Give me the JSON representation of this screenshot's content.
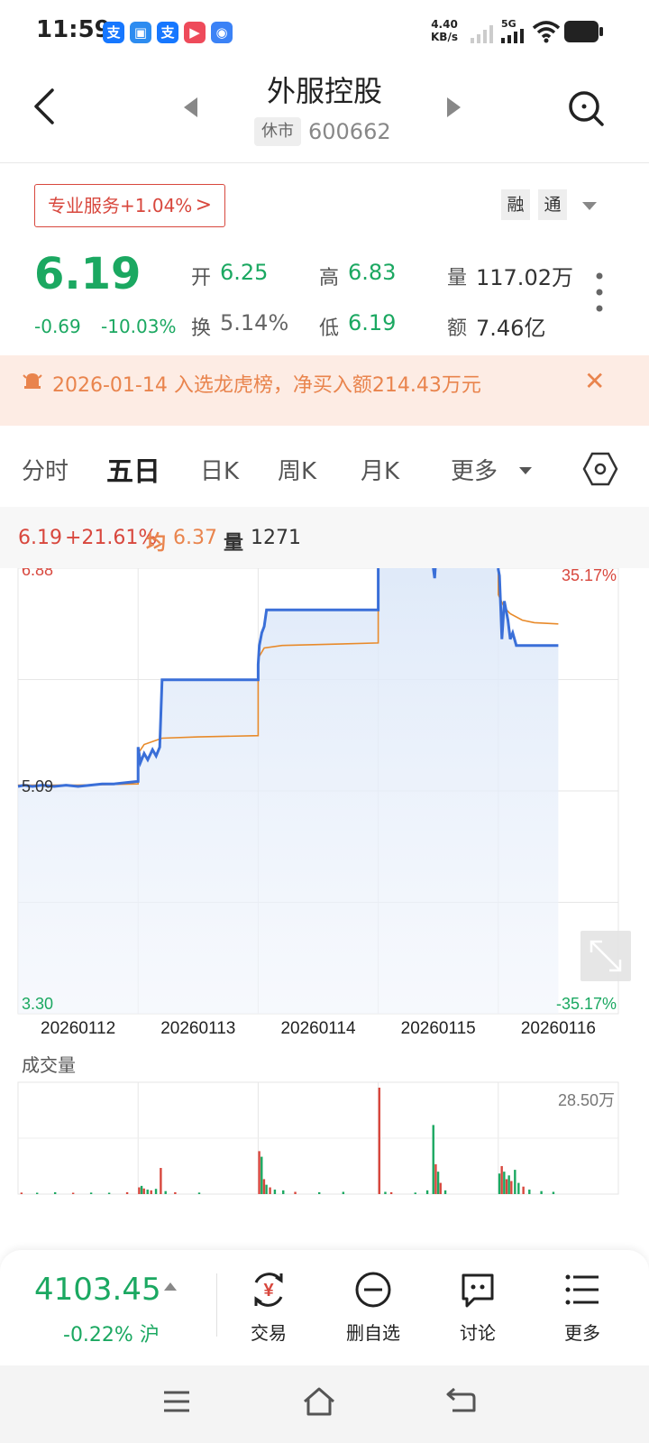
{
  "status_bar": {
    "time": "11:59",
    "net_speed": "4.40",
    "net_unit": "KB/s",
    "network": "5G",
    "app_icons": [
      {
        "icon": "alipay-icon",
        "glyph": "支",
        "color": "#1677ff"
      },
      {
        "icon": "app-blue-icon",
        "glyph": "▣",
        "color": "#2d8cf0"
      },
      {
        "icon": "alipay-icon",
        "glyph": "支",
        "color": "#1677ff"
      },
      {
        "icon": "video-app-icon",
        "glyph": "▶",
        "color": "#ee4a5a"
      },
      {
        "icon": "browser-app-icon",
        "glyph": "◉",
        "color": "#3b82f6"
      }
    ]
  },
  "header": {
    "title": "外服控股",
    "market_status": "休市",
    "code": "600662"
  },
  "pro_service": {
    "label": "专业服务+1.04%",
    "chevron": ">"
  },
  "chips": [
    "融",
    "通"
  ],
  "quote": {
    "price": "6.19",
    "change": "-0.69",
    "change_pct": "-10.03%",
    "open_label": "开",
    "open": "6.25",
    "high_label": "高",
    "high": "6.83",
    "volume_label": "量",
    "volume": "117.02万",
    "turnover_label": "换",
    "turnover": "5.14%",
    "low_label": "低",
    "low": "6.19",
    "amount_label": "额",
    "amount": "7.46亿"
  },
  "notice": {
    "text": "2026-01-14 入选龙虎榜，净买入额214.43万元",
    "close": "✕"
  },
  "tabs": [
    "分时",
    "五日",
    "日K",
    "周K",
    "月K",
    "更多"
  ],
  "info_strip": {
    "price": "6.19",
    "pct": "+21.61%",
    "avg_label": "均",
    "avg": "6.37",
    "vol_label": "量",
    "vol": "1271"
  },
  "chart_data": {
    "type": "line",
    "price_axis": {
      "top": "6.88",
      "mid": "5.09",
      "bottom": "3.30",
      "pct_top": "35.17%",
      "pct_bottom": "-35.17%"
    },
    "ylim": [
      3.3,
      6.88
    ],
    "dates": [
      "20260112",
      "20260113",
      "20260114",
      "20260115",
      "20260116"
    ],
    "series": [
      {
        "name": "price",
        "color": "#3a6fd8",
        "x": [
          0,
          0.05,
          0.12,
          0.2,
          0.3,
          0.4,
          0.5,
          0.6,
          0.7,
          0.8,
          0.9,
          1.0,
          1.0,
          1.02,
          1.05,
          1.08,
          1.12,
          1.15,
          1.18,
          1.2,
          1.3,
          1.5,
          1.7,
          1.9,
          2.0,
          2.0,
          2.01,
          2.03,
          2.05,
          2.07,
          2.1,
          2.3,
          2.5,
          2.7,
          2.9,
          3.0,
          3.0,
          3.01,
          3.2,
          3.4,
          3.45,
          3.46,
          3.47,
          3.48,
          3.5,
          3.6,
          3.8,
          3.95,
          4.0,
          4.0,
          4.01,
          4.02,
          4.03,
          4.05,
          4.08,
          4.1,
          4.12,
          4.15,
          4.2,
          4.3,
          4.4,
          4.5
        ],
        "y": [
          5.09,
          5.1,
          5.09,
          5.1,
          5.09,
          5.1,
          5.09,
          5.1,
          5.11,
          5.11,
          5.12,
          5.13,
          5.4,
          5.28,
          5.35,
          5.3,
          5.38,
          5.33,
          5.4,
          5.93,
          5.93,
          5.93,
          5.93,
          5.93,
          5.93,
          6.05,
          6.2,
          6.3,
          6.35,
          6.48,
          6.48,
          6.48,
          6.48,
          6.48,
          6.48,
          6.48,
          6.88,
          6.9,
          6.9,
          6.9,
          6.9,
          6.8,
          6.73,
          6.88,
          6.9,
          6.9,
          6.9,
          6.9,
          6.9,
          6.8,
          6.75,
          6.5,
          6.25,
          6.55,
          6.4,
          6.25,
          6.3,
          6.2,
          6.2,
          6.2,
          6.2,
          6.2
        ]
      },
      {
        "name": "average",
        "color": "#e88a2a",
        "x": [
          0,
          0.5,
          1.0,
          1.0,
          1.05,
          1.2,
          1.5,
          2.0,
          2.0,
          2.05,
          2.2,
          3.0,
          3.0,
          3.2,
          3.6,
          4.0,
          4.0,
          4.05,
          4.1,
          4.2,
          4.3,
          4.5
        ],
        "y": [
          5.1,
          5.1,
          5.11,
          5.35,
          5.42,
          5.47,
          5.48,
          5.49,
          6.1,
          6.18,
          6.2,
          6.22,
          6.87,
          6.87,
          6.88,
          6.88,
          6.6,
          6.5,
          6.45,
          6.4,
          6.38,
          6.37
        ]
      }
    ],
    "volume": {
      "title": "成交量",
      "max_label": "28.50万",
      "max": 28.5,
      "bars": [
        {
          "x": 0.02,
          "v": 0.4,
          "c": "r"
        },
        {
          "x": 0.15,
          "v": 0.3,
          "c": "g"
        },
        {
          "x": 0.3,
          "v": 0.5,
          "c": "g"
        },
        {
          "x": 0.45,
          "v": 0.3,
          "c": "r"
        },
        {
          "x": 0.6,
          "v": 0.4,
          "c": "g"
        },
        {
          "x": 0.75,
          "v": 0.3,
          "c": "g"
        },
        {
          "x": 0.9,
          "v": 0.5,
          "c": "r"
        },
        {
          "x": 1.0,
          "v": 1.8,
          "c": "r"
        },
        {
          "x": 1.02,
          "v": 2.2,
          "c": "g"
        },
        {
          "x": 1.04,
          "v": 1.5,
          "c": "r"
        },
        {
          "x": 1.07,
          "v": 1.2,
          "c": "g"
        },
        {
          "x": 1.1,
          "v": 1.0,
          "c": "r"
        },
        {
          "x": 1.14,
          "v": 1.4,
          "c": "g"
        },
        {
          "x": 1.18,
          "v": 7.0,
          "c": "r"
        },
        {
          "x": 1.22,
          "v": 0.8,
          "c": "g"
        },
        {
          "x": 1.3,
          "v": 0.5,
          "c": "r"
        },
        {
          "x": 1.5,
          "v": 0.4,
          "c": "g"
        },
        {
          "x": 2.0,
          "v": 11.5,
          "c": "r"
        },
        {
          "x": 2.02,
          "v": 10.0,
          "c": "g"
        },
        {
          "x": 2.04,
          "v": 4.0,
          "c": "r"
        },
        {
          "x": 2.06,
          "v": 2.5,
          "c": "g"
        },
        {
          "x": 2.09,
          "v": 1.8,
          "c": "r"
        },
        {
          "x": 2.13,
          "v": 1.2,
          "c": "g"
        },
        {
          "x": 2.2,
          "v": 1.0,
          "c": "g"
        },
        {
          "x": 2.3,
          "v": 0.6,
          "c": "r"
        },
        {
          "x": 2.5,
          "v": 0.5,
          "c": "g"
        },
        {
          "x": 2.7,
          "v": 0.6,
          "c": "g"
        },
        {
          "x": 3.0,
          "v": 28.5,
          "c": "r"
        },
        {
          "x": 3.05,
          "v": 0.6,
          "c": "g"
        },
        {
          "x": 3.1,
          "v": 0.5,
          "c": "r"
        },
        {
          "x": 3.3,
          "v": 0.4,
          "c": "g"
        },
        {
          "x": 3.4,
          "v": 1.0,
          "c": "g"
        },
        {
          "x": 3.45,
          "v": 18.5,
          "c": "g"
        },
        {
          "x": 3.47,
          "v": 8.0,
          "c": "r"
        },
        {
          "x": 3.49,
          "v": 6.0,
          "c": "g"
        },
        {
          "x": 3.51,
          "v": 3.0,
          "c": "r"
        },
        {
          "x": 3.55,
          "v": 1.0,
          "c": "g"
        },
        {
          "x": 4.0,
          "v": 5.5,
          "c": "g"
        },
        {
          "x": 4.02,
          "v": 7.5,
          "c": "r"
        },
        {
          "x": 4.04,
          "v": 6.0,
          "c": "g"
        },
        {
          "x": 4.06,
          "v": 4.0,
          "c": "r"
        },
        {
          "x": 4.08,
          "v": 5.0,
          "c": "g"
        },
        {
          "x": 4.1,
          "v": 3.5,
          "c": "r"
        },
        {
          "x": 4.13,
          "v": 6.5,
          "c": "g"
        },
        {
          "x": 4.16,
          "v": 3.0,
          "c": "g"
        },
        {
          "x": 4.2,
          "v": 2.0,
          "c": "r"
        },
        {
          "x": 4.25,
          "v": 1.2,
          "c": "g"
        },
        {
          "x": 4.35,
          "v": 0.8,
          "c": "g"
        },
        {
          "x": 4.45,
          "v": 0.6,
          "c": "g"
        }
      ]
    }
  },
  "bottom_bar": {
    "index_value": "4103.45",
    "index_change": "-0.22%",
    "index_name": "沪",
    "actions": [
      {
        "label": "交易",
        "icon": "trade-yuan-icon"
      },
      {
        "label": "删自选",
        "icon": "remove-watchlist-icon"
      },
      {
        "label": "讨论",
        "icon": "discussion-icon"
      },
      {
        "label": "更多",
        "icon": "menu-list-icon"
      }
    ]
  },
  "colors": {
    "up": "#d8473d",
    "down": "#1ba861",
    "accent": "#e9844d",
    "line": "#3a6fd8",
    "avg": "#e88a2a"
  }
}
